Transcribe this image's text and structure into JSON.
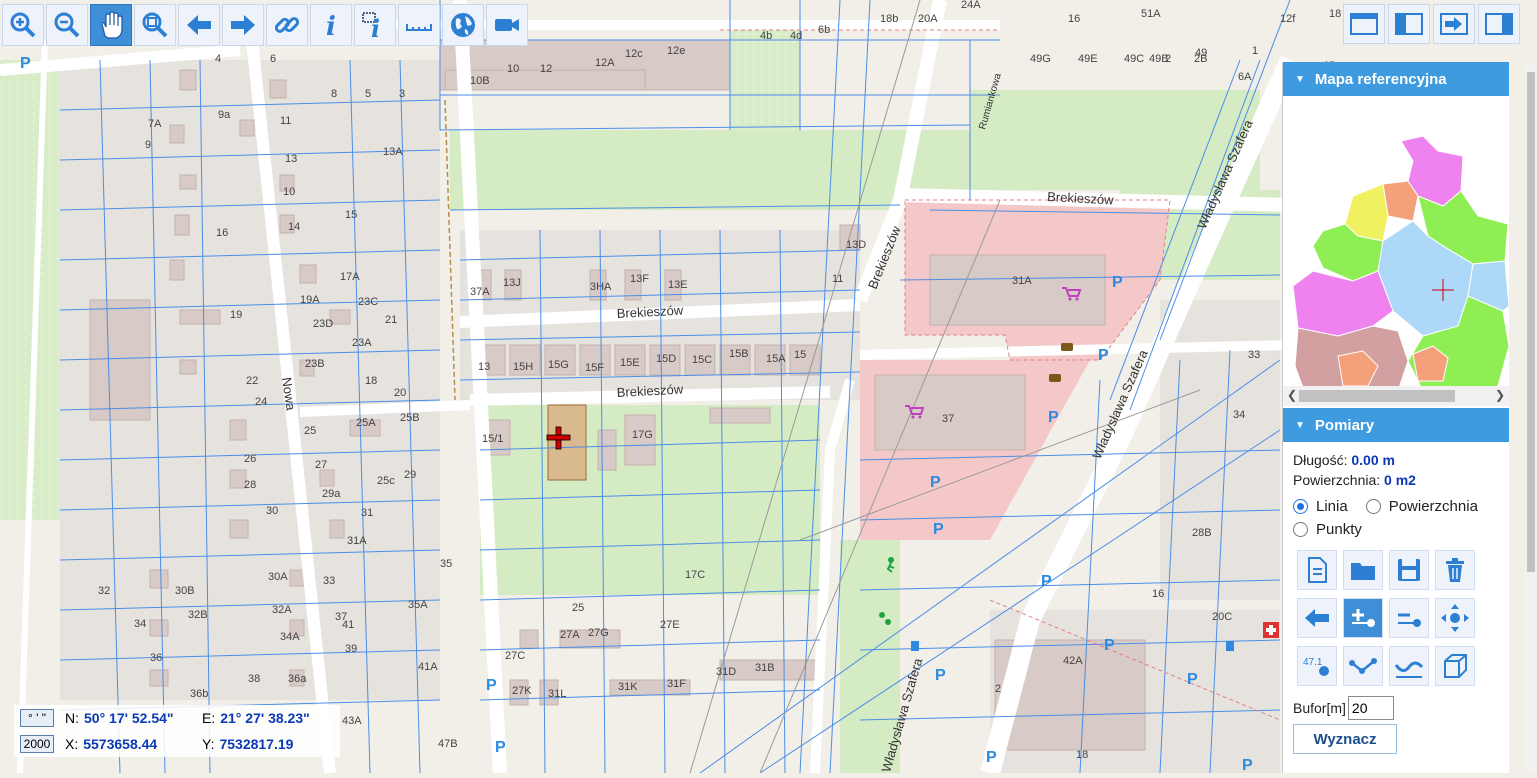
{
  "toolbar": {
    "buttons": [
      {
        "name": "zoom-in-icon"
      },
      {
        "name": "zoom-out-icon"
      },
      {
        "name": "pan-hand-icon",
        "active": true
      },
      {
        "name": "zoom-extent-icon"
      },
      {
        "name": "back-arrow-icon"
      },
      {
        "name": "forward-arrow-icon"
      },
      {
        "name": "link-icon"
      },
      {
        "name": "info-icon"
      },
      {
        "name": "info-select-icon"
      },
      {
        "name": "ruler-icon"
      },
      {
        "name": "globe-icon"
      },
      {
        "name": "video-camera-icon"
      }
    ]
  },
  "window_buttons": [
    "maximize-window-icon",
    "split-panel-icon",
    "export-icon",
    "dock-right-icon"
  ],
  "map": {
    "streets": [
      "Brekieszów",
      "Brekieszów",
      "Brekieszów",
      "Brekieszów",
      "Nowa",
      "Władysława Szafera",
      "Władysława Szafera",
      "Władysława Szafera",
      "Rumiankowa"
    ],
    "parking_label": "P",
    "building_numbers": [
      "18b",
      "20A",
      "24A",
      "16",
      "51A",
      "18",
      "4b",
      "4d",
      "6b",
      "10B",
      "10",
      "12",
      "12A",
      "12c",
      "12e",
      "12f",
      "49",
      "49G",
      "49E",
      "49C",
      "49B",
      "2",
      "2B",
      "4",
      "6",
      "8",
      "5",
      "3",
      "1",
      "6A",
      "6B",
      "7A",
      "9",
      "9a",
      "11",
      "13",
      "13A",
      "10",
      "15",
      "14",
      "16",
      "17A",
      "19",
      "19A",
      "23D",
      "23C",
      "21",
      "23A",
      "23B",
      "18",
      "20",
      "22",
      "24",
      "26",
      "28",
      "30",
      "30A",
      "30B",
      "32",
      "32A",
      "32B",
      "34",
      "34A",
      "36",
      "36a",
      "36b",
      "38",
      "39",
      "41",
      "41A",
      "43A",
      "47B",
      "25",
      "25A",
      "25B",
      "27",
      "25c",
      "29",
      "29a",
      "31",
      "31A",
      "33",
      "35",
      "35A",
      "37",
      "37A",
      "13J",
      "3HA",
      "13F",
      "13E",
      "13D",
      "11",
      "13",
      "15H",
      "15G",
      "15F",
      "15E",
      "15D",
      "15C",
      "15B",
      "15A",
      "15",
      "15/1",
      "17G",
      "17C",
      "25",
      "27A",
      "27G",
      "27E",
      "27C",
      "27K",
      "31L",
      "31K",
      "31F",
      "31D",
      "31B",
      "31A",
      "37",
      "33",
      "34",
      "28B",
      "20C",
      "42A",
      "2",
      "18",
      "16",
      "5"
    ],
    "crosshair": "+"
  },
  "panel": {
    "reference_map": {
      "title": "Mapa referencyjna",
      "regions": [
        {
          "color": "#ee82ee"
        },
        {
          "color": "#f4a07a"
        },
        {
          "color": "#f0f060"
        },
        {
          "color": "#90ee55"
        },
        {
          "color": "#90ee55"
        },
        {
          "color": "#add8f7"
        },
        {
          "color": "#ee82ee"
        },
        {
          "color": "#d2a0a0"
        },
        {
          "color": "#f4a07a"
        },
        {
          "color": "#90ee55"
        },
        {
          "color": "#f4a07a"
        },
        {
          "color": "#add8f7"
        }
      ]
    },
    "measure": {
      "title": "Pomiary",
      "length_label": "Długość:",
      "length_value": "0.00 m",
      "area_label": "Powierzchnia:",
      "area_value": "0 m2",
      "mode_line": "Linia",
      "mode_area": "Powierzchnia",
      "mode_points": "Punkty",
      "selected_mode": "Linia",
      "tools": [
        "new-document-icon",
        "open-folder-icon",
        "save-icon",
        "trash-icon",
        "undo-arrow-icon",
        "add-point-icon",
        "remove-point-icon",
        "move-icon",
        "label-value-icon",
        "polyline-icon",
        "curve-icon",
        "3d-box-icon"
      ],
      "label_value_text": "47.1",
      "buffer_label": "Bufor[m]",
      "buffer_value": "20",
      "compute_button": "Wyznacz"
    }
  },
  "coordinates": {
    "format_button": "° ' \"",
    "scale_button": "2000",
    "n_label": "N:",
    "n_value": "50° 17' 52.54\"",
    "e_label": "E:",
    "e_value": "21° 27' 38.23\"",
    "x_label": "X:",
    "x_value": "5573658.44",
    "y_label": "Y:",
    "y_value": "7532817.19"
  }
}
